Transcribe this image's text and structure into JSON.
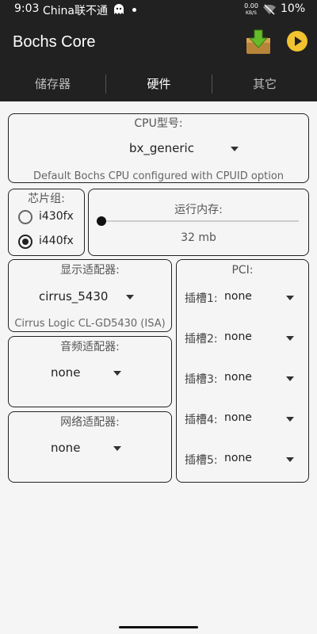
{
  "status": {
    "time": "9:03",
    "carrier": "China联不通",
    "speed_top": "0.00",
    "speed_unit": "KB/S",
    "battery": "10%"
  },
  "appbar": {
    "title": "Bochs Core",
    "accent_green": "#66bb2a",
    "accent_yellow": "#f2c230"
  },
  "tabs": [
    {
      "label": "储存器"
    },
    {
      "label": "硬件"
    },
    {
      "label": "其它"
    }
  ],
  "cpu": {
    "label": "CPU型号:",
    "value": "bx_generic",
    "description": "Default Bochs CPU configured with CPUID option"
  },
  "chipset": {
    "label": "芯片组:",
    "options": [
      {
        "label": "i430fx",
        "selected": false
      },
      {
        "label": "i440fx",
        "selected": true
      }
    ]
  },
  "memory": {
    "label": "运行内存:",
    "value": "32 mb",
    "slider_fraction": 0.0
  },
  "display": {
    "label": "显示适配器:",
    "value": "cirrus_5430",
    "description": "Cirrus Logic CL-GD5430 (ISA)"
  },
  "audio": {
    "label": "音频适配器:",
    "value": "none"
  },
  "network": {
    "label": "网络适配器:",
    "value": "none"
  },
  "pci": {
    "label": "PCI:",
    "slots": [
      {
        "label": "插槽1:",
        "value": "none"
      },
      {
        "label": "插槽2:",
        "value": "none"
      },
      {
        "label": "插槽3:",
        "value": "none"
      },
      {
        "label": "插槽4:",
        "value": "none"
      },
      {
        "label": "插槽5:",
        "value": "none"
      }
    ]
  }
}
